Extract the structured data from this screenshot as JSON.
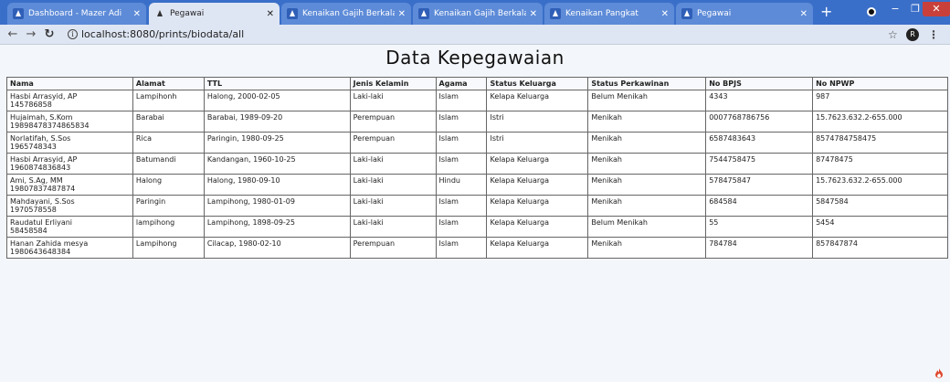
{
  "browser": {
    "tabs": [
      {
        "title": "Dashboard - Mazer Adi",
        "active": false
      },
      {
        "title": "Pegawai",
        "active": true
      },
      {
        "title": "Kenaikan Gajih Berkala",
        "active": false
      },
      {
        "title": "Kenaikan Gajih Berkala",
        "active": false
      },
      {
        "title": "Kenaikan Pangkat",
        "active": false
      },
      {
        "title": "Pegawai",
        "active": false
      }
    ],
    "new_tab": "+",
    "url": "localhost:8080/prints/biodata/all",
    "profile_initial": "R",
    "accent": "#3a6fc9"
  },
  "page": {
    "title": "Data Kepegawaian",
    "columns": [
      "Nama",
      "Alamat",
      "TTL",
      "Jenis Kelamin",
      "Agama",
      "Status Keluarga",
      "Status Perkawinan",
      "No BPJS",
      "No NPWP"
    ],
    "rows": [
      {
        "nama": "Hasbi Arrasyid, AP",
        "nip": "145786858",
        "alamat": "Lampihonh",
        "ttl": "Halong, 2000-02-05",
        "jk": "Laki-laki",
        "agama": "Islam",
        "status_keluarga": "Kelapa Keluarga",
        "status_perkawinan": "Belum Menikah",
        "bpjs": "4343",
        "npwp": "987"
      },
      {
        "nama": "Hujaimah, S.Kom",
        "nip": "19898478374865834",
        "alamat": "Barabai",
        "ttl": "Barabai, 1989-09-20",
        "jk": "Perempuan",
        "agama": "Islam",
        "status_keluarga": "Istri",
        "status_perkawinan": "Menikah",
        "bpjs": "0007768786756",
        "npwp": "15.7623.632.2-655.000"
      },
      {
        "nama": "Norlatifah, S.Sos",
        "nip": "1965748343",
        "alamat": "Rica",
        "ttl": "Paringin, 1980-09-25",
        "jk": "Perempuan",
        "agama": "Islam",
        "status_keluarga": "Istri",
        "status_perkawinan": "Menikah",
        "bpjs": "6587483643",
        "npwp": "8574784758475"
      },
      {
        "nama": "Hasbi Arrasyid, AP",
        "nip": "1960874836843",
        "alamat": "Batumandi",
        "ttl": "Kandangan, 1960-10-25",
        "jk": "Laki-laki",
        "agama": "Islam",
        "status_keluarga": "Kelapa Keluarga",
        "status_perkawinan": "Menikah",
        "bpjs": "7544758475",
        "npwp": "87478475"
      },
      {
        "nama": "Ami, S.Ag, MM",
        "nip": "19807837487874",
        "alamat": "Halong",
        "ttl": "Halong, 1980-09-10",
        "jk": "Laki-laki",
        "agama": "Hindu",
        "status_keluarga": "Kelapa Keluarga",
        "status_perkawinan": "Menikah",
        "bpjs": "578475847",
        "npwp": "15.7623.632.2-655.000"
      },
      {
        "nama": "Mahdayani, S.Sos",
        "nip": "1970578558",
        "alamat": "Paringin",
        "ttl": "Lampihong, 1980-01-09",
        "jk": "Laki-laki",
        "agama": "Islam",
        "status_keluarga": "Kelapa Keluarga",
        "status_perkawinan": "Menikah",
        "bpjs": "684584",
        "npwp": "5847584"
      },
      {
        "nama": "Raudatul Erliyani",
        "nip": "58458584",
        "alamat": "lampihong",
        "ttl": "Lampihong, 1898-09-25",
        "jk": "Laki-laki",
        "agama": "Islam",
        "status_keluarga": "Kelapa Keluarga",
        "status_perkawinan": "Belum Menikah",
        "bpjs": "55",
        "npwp": "5454"
      },
      {
        "nama": "Hanan Zahida mesya",
        "nip": "1980643648384",
        "alamat": "Lampihong",
        "ttl": "Cilacap, 1980-02-10",
        "jk": "Perempuan",
        "agama": "Islam",
        "status_keluarga": "Kelapa Keluarga",
        "status_perkawinan": "Menikah",
        "bpjs": "784784",
        "npwp": "857847874"
      }
    ]
  }
}
